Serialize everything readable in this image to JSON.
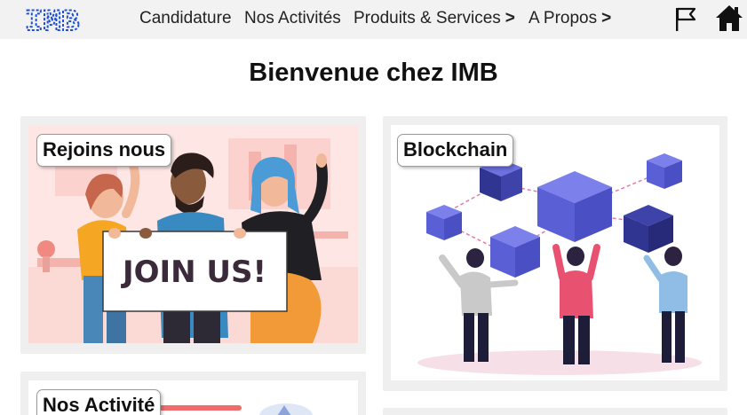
{
  "brand": {
    "logo_text": "IMB",
    "logo_color": "#1f4fd6"
  },
  "nav": {
    "items": [
      {
        "label": "Candidature",
        "has_submenu": false
      },
      {
        "label": "Nos Activités",
        "has_submenu": false
      },
      {
        "label": "Produits & Services",
        "has_submenu": true,
        "chevron": ">"
      },
      {
        "label": "A Propos",
        "has_submenu": true,
        "chevron": ">"
      }
    ],
    "icons": [
      "flag-icon",
      "home-icon"
    ]
  },
  "page": {
    "title": "Bienvenue chez IMB"
  },
  "cards": [
    {
      "label": "Rejoins nous",
      "banner_text": "JOIN US!"
    },
    {
      "label": "Blockchain"
    },
    {
      "label": "Nos Activité"
    }
  ],
  "colors": {
    "navbar_bg": "#f2f2f2",
    "card_bg": "#efefef",
    "join_bg": "#fde6e4",
    "cube_blue": "#5b5fd6",
    "cube_dark": "#2f3590"
  }
}
